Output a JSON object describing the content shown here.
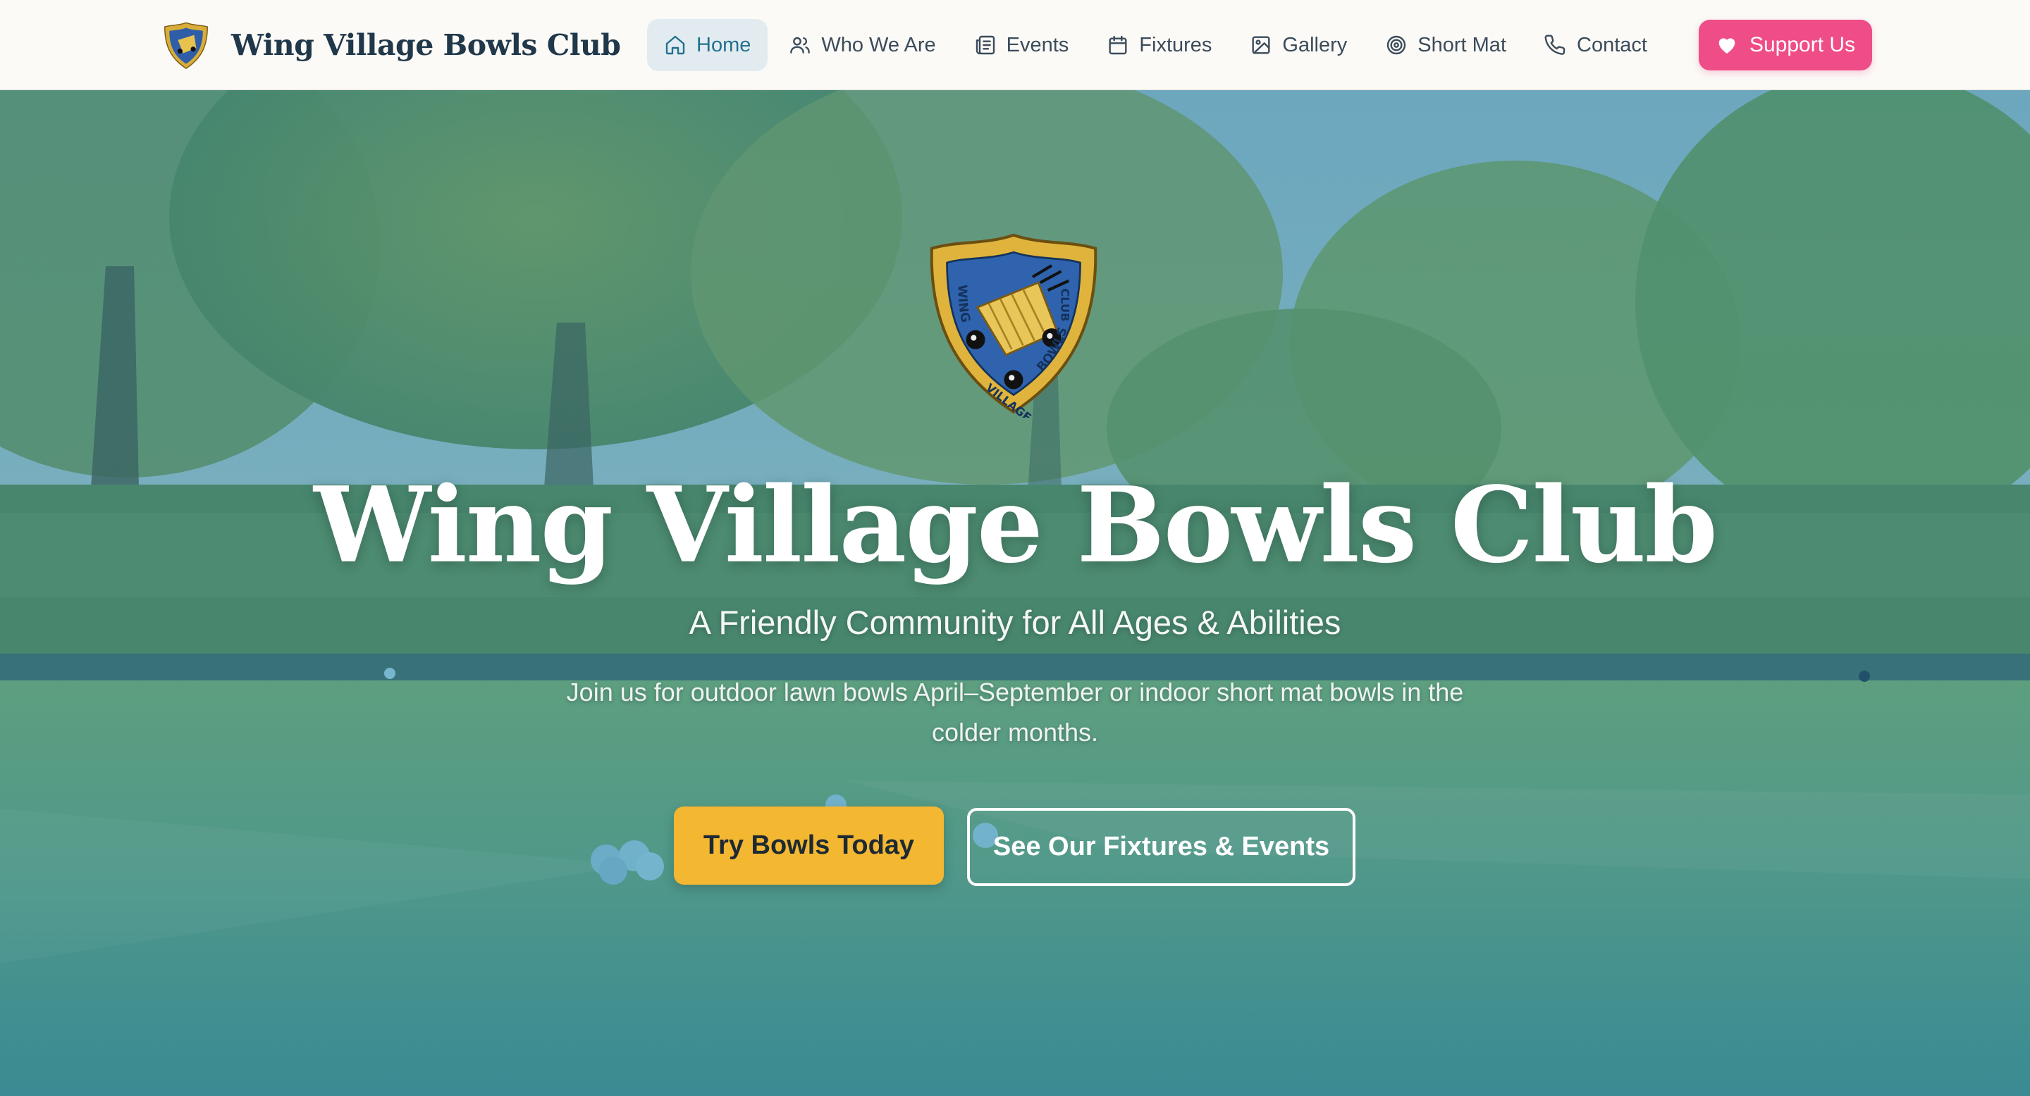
{
  "brand": {
    "name": "Wing Village Bowls Club"
  },
  "nav": {
    "items": [
      {
        "label": "Home",
        "icon": "home-icon",
        "active": true
      },
      {
        "label": "Who We Are",
        "icon": "users-icon",
        "active": false
      },
      {
        "label": "Events",
        "icon": "newspaper-icon",
        "active": false
      },
      {
        "label": "Fixtures",
        "icon": "calendar-icon",
        "active": false
      },
      {
        "label": "Gallery",
        "icon": "image-icon",
        "active": false
      },
      {
        "label": "Short Mat",
        "icon": "target-icon",
        "active": false
      },
      {
        "label": "Contact",
        "icon": "phone-icon",
        "active": false
      }
    ],
    "support_label": "Support Us"
  },
  "hero": {
    "crest_text": {
      "left": "WING",
      "bottom": "VILLAGE",
      "right": "BOWLS",
      "top_right": "CLUB"
    },
    "title": "Wing Village Bowls Club",
    "subtitle": "A Friendly Community for All Ages & Abilities",
    "description": "Join us for outdoor lawn bowls April–September or indoor short mat bowls in the colder months.",
    "primary_cta": "Try Bowls Today",
    "secondary_cta": "See Our Fixtures & Events"
  },
  "colors": {
    "nav_text": "#3b4b5a",
    "nav_active_bg": "#e2ecf0",
    "nav_active_text": "#23708f",
    "support": "#ef4d87",
    "primary_cta": "#f4b731",
    "crest_blue": "#2f63ad",
    "crest_gold": "#e0b43c"
  }
}
